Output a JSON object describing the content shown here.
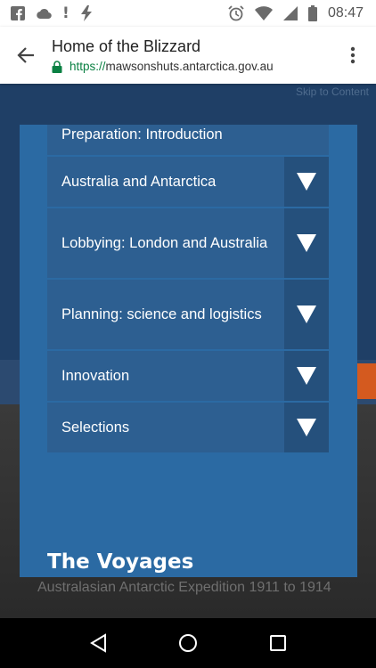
{
  "status_bar": {
    "time": "08:47",
    "left_icons": [
      "facebook-icon",
      "cloud-icon",
      "alert-icon",
      "flash-icon"
    ],
    "right_icons": [
      "alarm-icon",
      "wifi-icon",
      "signal-icon",
      "battery-icon"
    ]
  },
  "address_bar": {
    "title": "Home of the Blizzard",
    "url_scheme": "https://",
    "url_host": "mawsonshuts.antarctica.gov.au"
  },
  "background": {
    "skip_link": "Skip to Content",
    "footer_text": "Australasian Antarctic Expedition 1911 to 1914"
  },
  "modal": {
    "nav_items": [
      {
        "label": "Preparation: Introduction",
        "has_toggle": false
      },
      {
        "label": "Australia and Antarctica",
        "has_toggle": true
      },
      {
        "label": "Lobbying: London and Australia",
        "has_toggle": true
      },
      {
        "label": "Planning: science and logistics",
        "has_toggle": true
      },
      {
        "label": "Innovation",
        "has_toggle": true
      },
      {
        "label": "Selections",
        "has_toggle": true
      }
    ],
    "section_heading": "The Voyages"
  },
  "colors": {
    "modal_bg": "#2b6aa3",
    "item_bg": "#2d5f91",
    "toggle_bg": "#25507c",
    "url_scheme": "#0b8043"
  }
}
